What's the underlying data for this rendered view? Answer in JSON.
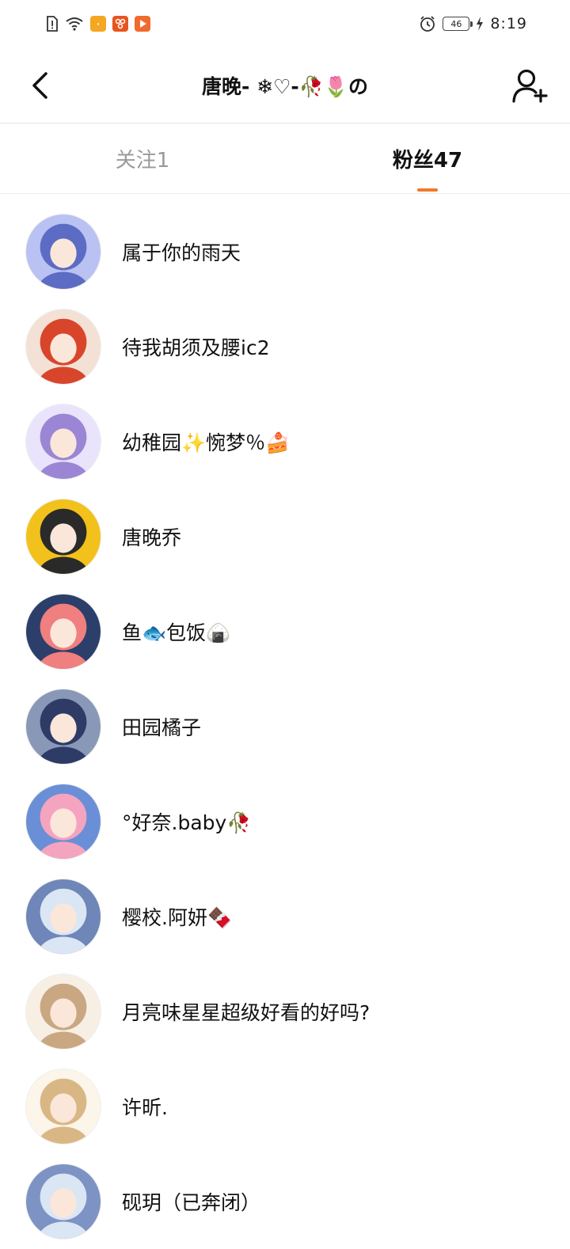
{
  "status_bar": {
    "icons_left": [
      "sim-alert-icon",
      "wifi-icon",
      "app-icon-orange",
      "app-icon-weibo",
      "app-icon-video"
    ],
    "battery_level": "46",
    "time": "8:19"
  },
  "header": {
    "title": "唐晚- ❄♡-🥀🌷の",
    "back_icon": "chevron-left-icon",
    "add_icon": "add-user-icon"
  },
  "tabs": [
    {
      "label": "关注1",
      "active": false
    },
    {
      "label": "粉丝47",
      "active": true
    }
  ],
  "colors": {
    "accent": "#f07a2a",
    "inactive_tab": "#9a9a9a",
    "text": "#111111"
  },
  "followers": [
    {
      "name": "属于你的雨天",
      "avatar_colors": [
        "#5c6cc4",
        "#b9c2f2"
      ]
    },
    {
      "name": "待我胡须及腰ic2",
      "avatar_colors": [
        "#d9452b",
        "#f3e1d6"
      ]
    },
    {
      "name": "幼稚园✨惋梦％🍰",
      "avatar_colors": [
        "#9a86d4",
        "#e9e3fb"
      ]
    },
    {
      "name": "唐晚乔",
      "avatar_colors": [
        "#2a2a2a",
        "#f2c11b"
      ]
    },
    {
      "name": "鱼🐟包饭🍙",
      "avatar_colors": [
        "#f07f7f",
        "#2b3f6a"
      ]
    },
    {
      "name": "田园橘子",
      "avatar_colors": [
        "#2e3b66",
        "#8a98b8"
      ]
    },
    {
      "name": "°好奈.baby🥀",
      "avatar_colors": [
        "#f5a4c0",
        "#6b8fd6"
      ]
    },
    {
      "name": "樱校.阿妍🍫",
      "avatar_colors": [
        "#dbe6f5",
        "#6f86b8"
      ]
    },
    {
      "name": "月亮味星星超级好看的好吗?",
      "avatar_colors": [
        "#c9a781",
        "#f7eee4"
      ]
    },
    {
      "name": "许昕.",
      "avatar_colors": [
        "#d9b785",
        "#fbf5ea"
      ]
    },
    {
      "name": "砚玥（已奔闭）",
      "avatar_colors": [
        "#dbe6f5",
        "#7d93c4"
      ]
    }
  ]
}
